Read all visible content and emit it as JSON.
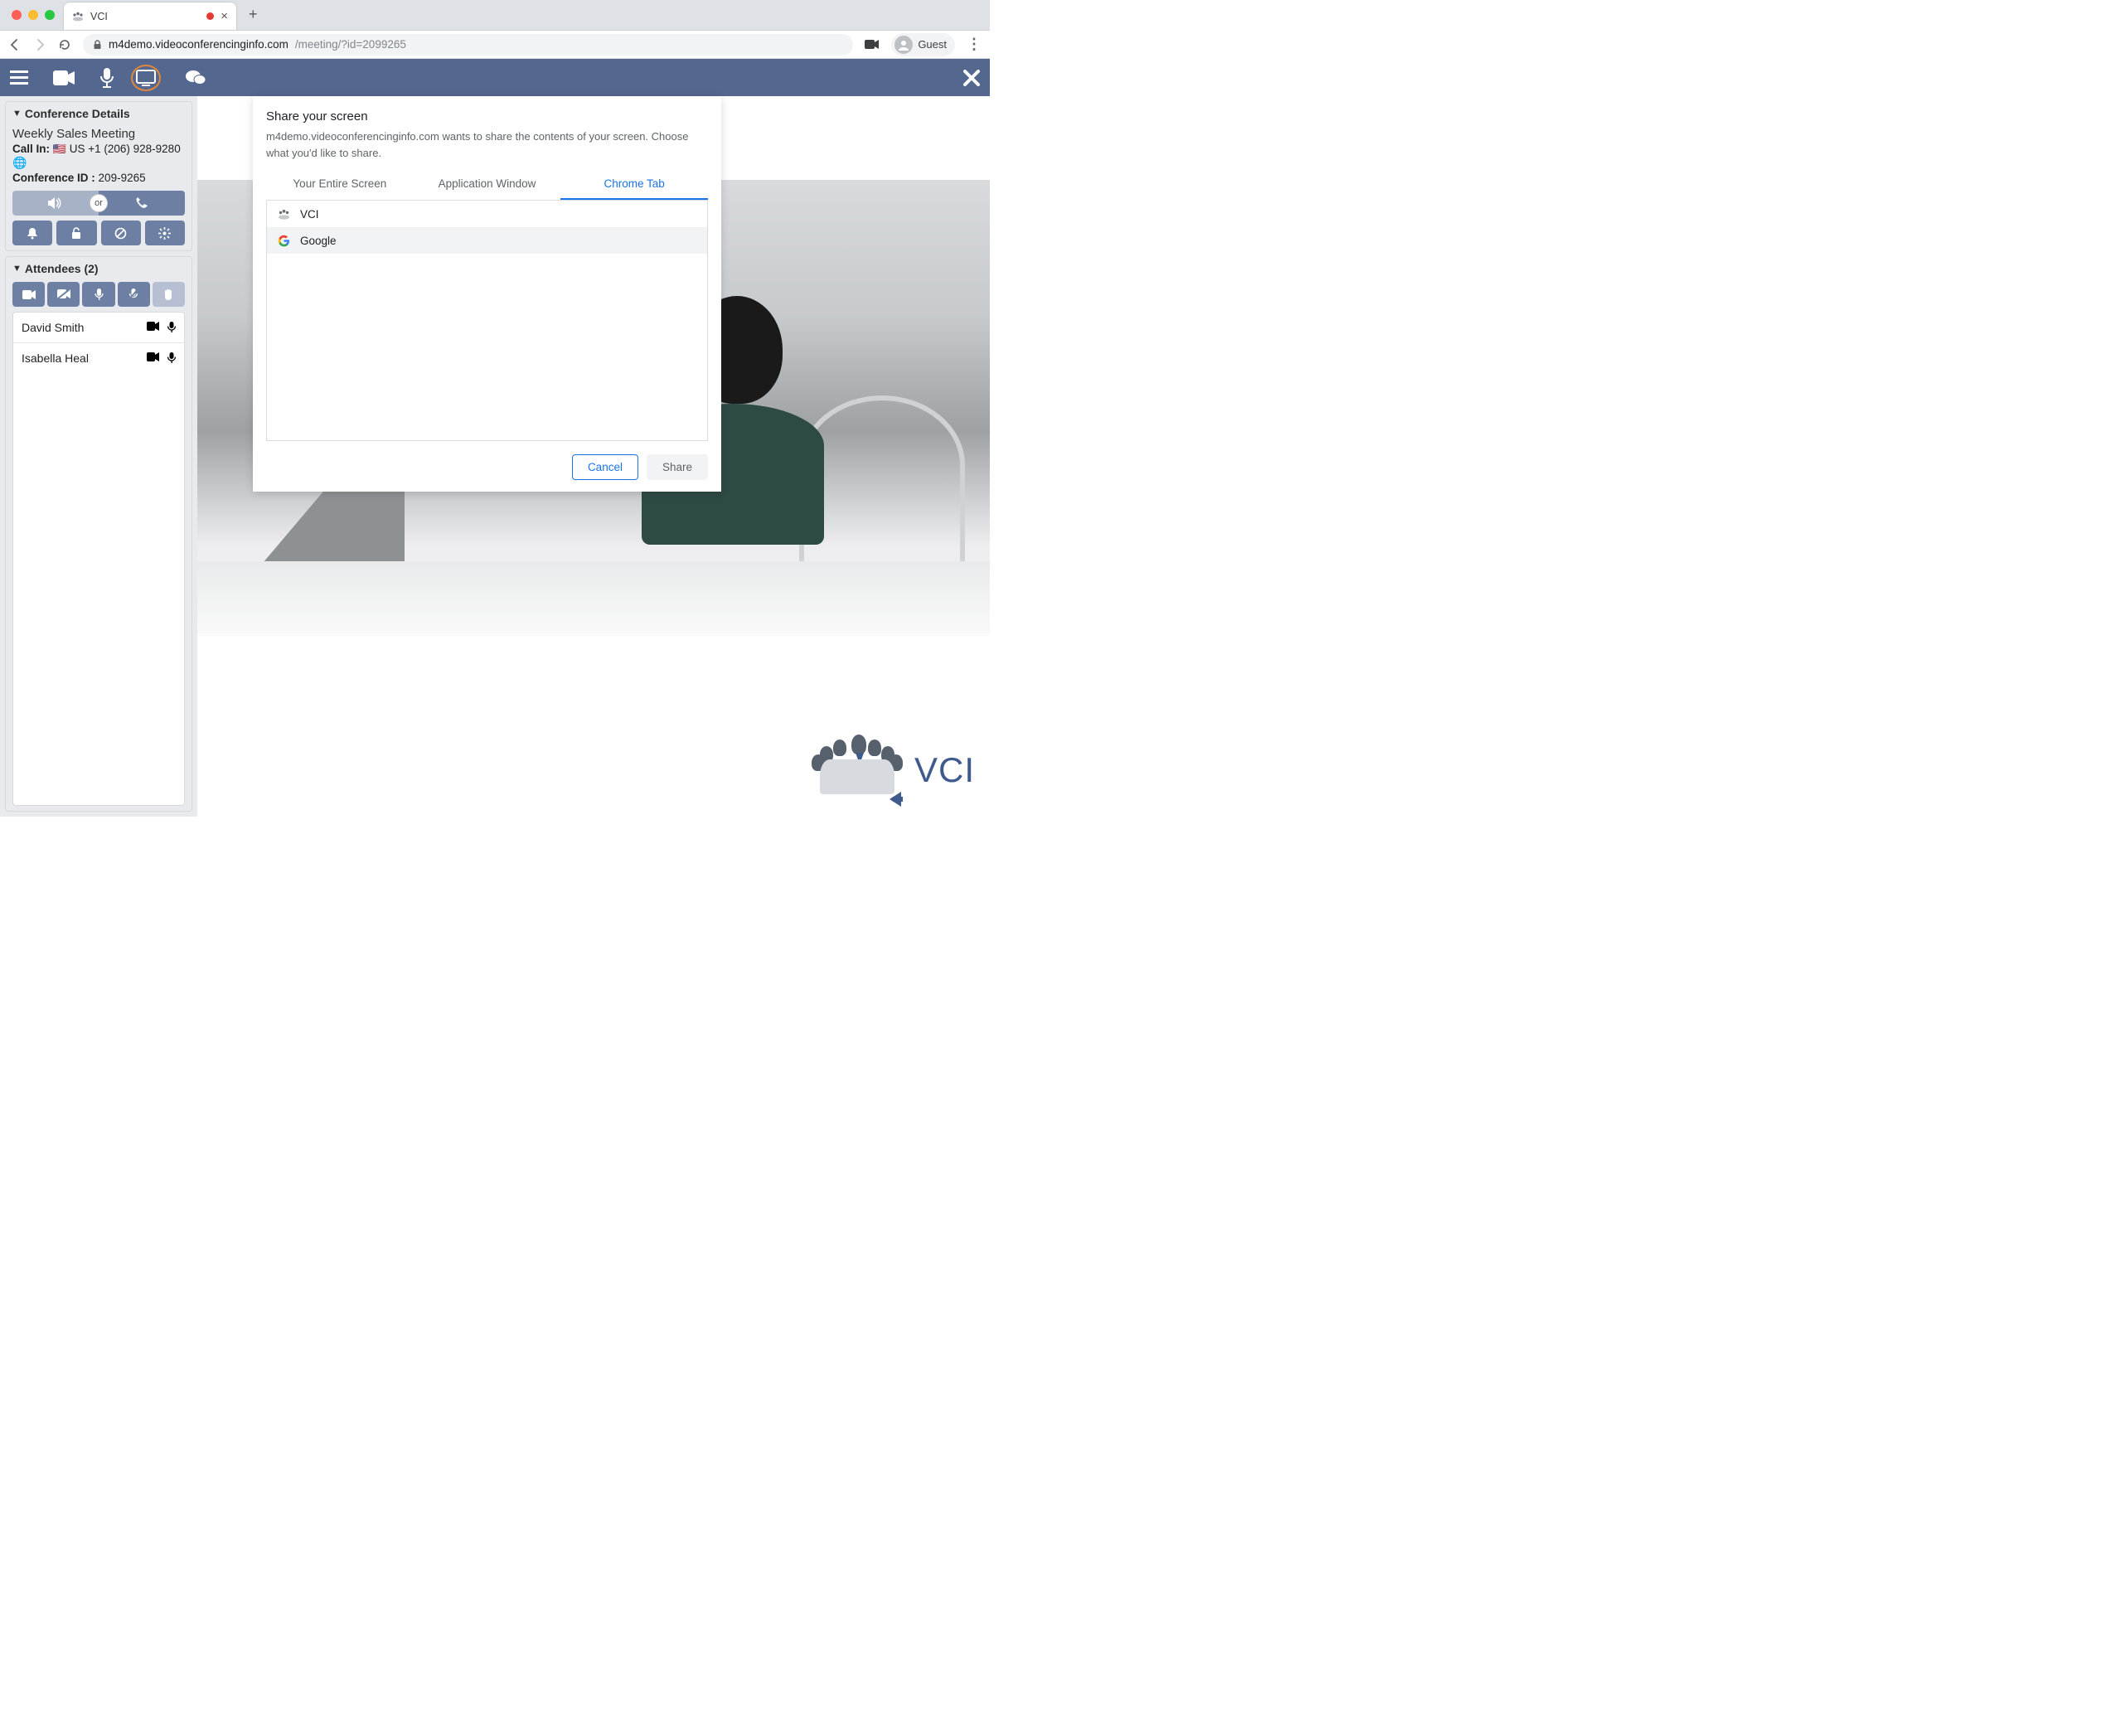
{
  "browser": {
    "tab_title": "VCI",
    "url_domain": "m4demo.videoconferencinginfo.com",
    "url_path": "/meeting/?id=2099265",
    "guest_label": "Guest"
  },
  "sidebar": {
    "conference_details": {
      "header": "Conference Details",
      "title": "Weekly Sales Meeting",
      "callin_label": "Call In:",
      "callin_value": "US +1 (206) 928-9280",
      "confid_label": "Conference ID :",
      "confid_value": "209-9265",
      "or_label": "or"
    },
    "attendees": {
      "header": "Attendees (2)",
      "list": [
        {
          "name": "David Smith"
        },
        {
          "name": "Isabella Heal"
        }
      ]
    }
  },
  "dialog": {
    "title": "Share your screen",
    "description": "m4demo.videoconferencinginfo.com wants to share the contents of your screen. Choose what you'd like to share.",
    "tabs": {
      "entire": "Your Entire Screen",
      "appwin": "Application Window",
      "chrometab": "Chrome Tab"
    },
    "sources": {
      "vci": "VCI",
      "google": "Google"
    },
    "cancel": "Cancel",
    "share": "Share"
  },
  "logo": {
    "text": "VCI"
  }
}
